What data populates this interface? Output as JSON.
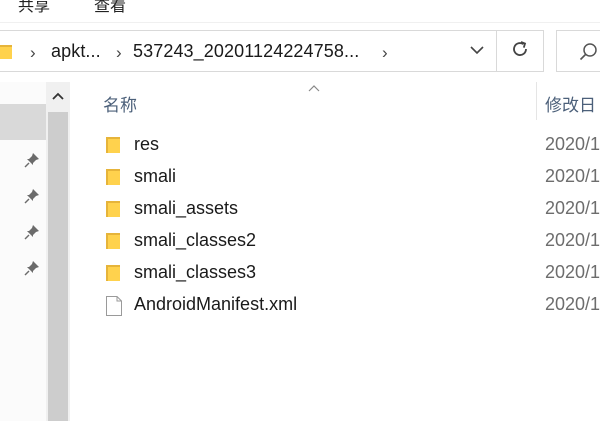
{
  "ribbon": {
    "tabs": [
      "共享",
      "查看"
    ]
  },
  "address": {
    "segment_1": "apkt...",
    "segment_2": "537243_20201124224758..."
  },
  "icons": {
    "address_folder": "folder-icon",
    "dropdown": "chevron-down-icon",
    "refresh": "refresh-icon",
    "search": "search-icon",
    "pin": "pin-icon",
    "scroll_up": "chevron-up-icon",
    "sort": "sort-caret-icon"
  },
  "columns": {
    "name": "名称",
    "modified": "修改日"
  },
  "files": [
    {
      "name": "res",
      "date": "2020/1",
      "type": "folder"
    },
    {
      "name": "smali",
      "date": "2020/1",
      "type": "folder"
    },
    {
      "name": "smali_assets",
      "date": "2020/1",
      "type": "folder"
    },
    {
      "name": "smali_classes2",
      "date": "2020/1",
      "type": "folder"
    },
    {
      "name": "smali_classes3",
      "date": "2020/1",
      "type": "folder"
    },
    {
      "name": "AndroidManifest.xml",
      "date": "2020/1",
      "type": "file"
    }
  ],
  "colors": {
    "folder": "#ffd24d",
    "folder_dark": "#e6b43a",
    "header_text": "#4c607a",
    "selected": "#d9d9d9"
  }
}
